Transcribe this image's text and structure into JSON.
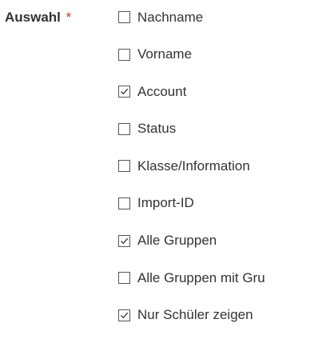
{
  "field": {
    "label": "Auswahl",
    "required_mark": "*"
  },
  "options": [
    {
      "label": "Nachname",
      "checked": false
    },
    {
      "label": "Vorname",
      "checked": false
    },
    {
      "label": "Account",
      "checked": true
    },
    {
      "label": "Status",
      "checked": false
    },
    {
      "label": "Klasse/Information",
      "checked": false
    },
    {
      "label": "Import-ID",
      "checked": false
    },
    {
      "label": "Alle Gruppen",
      "checked": true
    },
    {
      "label": "Alle Gruppen mit Gru",
      "checked": false
    },
    {
      "label": "Nur Schüler zeigen",
      "checked": true
    }
  ],
  "colors": {
    "required": "#c0392b",
    "text": "#333333",
    "checkbox_border": "#555555"
  }
}
